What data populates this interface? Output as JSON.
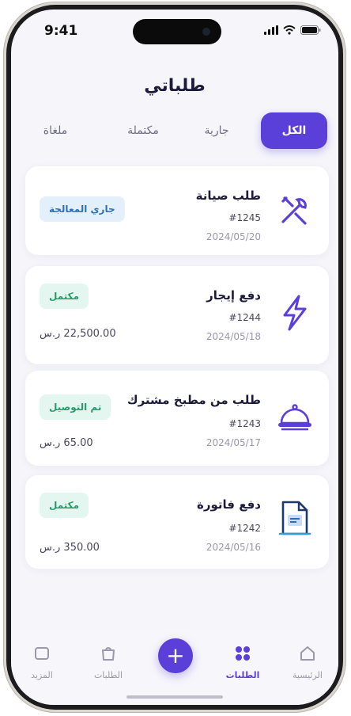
{
  "status_bar": {
    "time": "9:41"
  },
  "header": {
    "title": "طلباتي"
  },
  "tabs": [
    {
      "label": "الكل",
      "active": true
    },
    {
      "label": "جارية",
      "active": false
    },
    {
      "label": "مكتملة",
      "active": false
    },
    {
      "label": "ملغاة",
      "active": false
    }
  ],
  "orders": [
    {
      "title": "طلب صيانة",
      "number": "#1245",
      "date": "2024/05/20",
      "status": "جاري المعالجة",
      "status_color": "blue",
      "amount": "",
      "icon": "tools-icon"
    },
    {
      "title": "دفع إيجار",
      "number": "#1244",
      "date": "2024/05/18",
      "status": "مكتمل",
      "status_color": "green",
      "amount": "22,500.00 ر.س",
      "icon": "lightning-icon"
    },
    {
      "title": "طلب من مطبخ مشترك",
      "number": "#1243",
      "date": "2024/05/17",
      "status": "تم التوصيل",
      "status_color": "green",
      "amount": "65.00 ر.س",
      "icon": "food-cloche-icon"
    },
    {
      "title": "دفع فاتورة",
      "number": "#1242",
      "date": "2024/05/16",
      "status": "مكتمل",
      "status_color": "green",
      "amount": "350.00 ر.س",
      "icon": "invoice-icon"
    }
  ],
  "bottom_nav": {
    "items": [
      {
        "label": "الرئيسية",
        "icon": "home-icon"
      },
      {
        "label": "الطلبات",
        "icon": "grid-icon",
        "active": true
      },
      {
        "label": "الطلبات",
        "icon": "bag-icon"
      },
      {
        "label": "المزيد",
        "icon": "more-icon"
      }
    ],
    "fab": "+"
  },
  "colors": {
    "accent": "#5b3fd9",
    "background": "#f5f5fa"
  }
}
